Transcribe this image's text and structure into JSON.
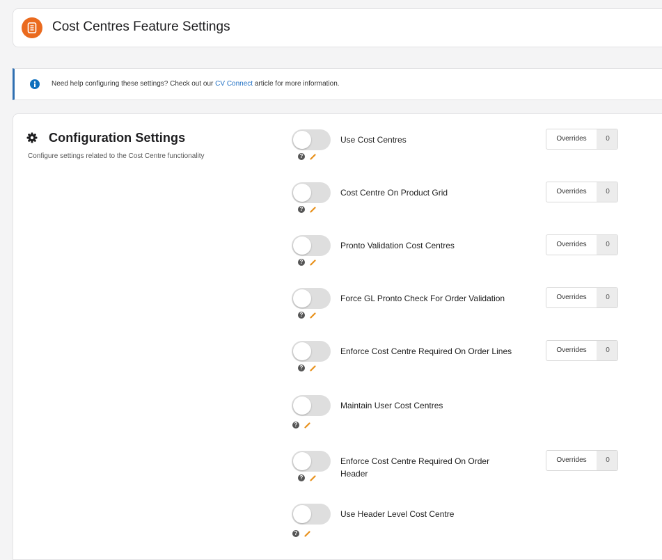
{
  "header": {
    "title": "Cost Centres Feature Settings",
    "icon": "document-icon",
    "accent_color": "#ea6a1e"
  },
  "help": {
    "prefix": "Need help configuring these settings? Check out our ",
    "link_text": "CV Connect",
    "suffix": " article for more information.",
    "icon": "info-icon"
  },
  "config": {
    "title": "Configuration Settings",
    "subtitle": "Configure settings related to the Cost Centre functionality",
    "icon": "gear-icon",
    "overrides_label": "Overrides",
    "settings": [
      {
        "label": "Use Cost Centres",
        "enabled": false,
        "overrides": "0"
      },
      {
        "label": "Cost Centre On Product Grid",
        "enabled": false,
        "overrides": "0"
      },
      {
        "label": "Pronto Validation Cost Centres",
        "enabled": false,
        "overrides": "0"
      },
      {
        "label": "Force GL Pronto Check For Order Validation",
        "enabled": false,
        "overrides": "0"
      },
      {
        "label": "Enforce Cost Centre Required On Order Lines",
        "enabled": false,
        "overrides": "0"
      },
      {
        "label": "Maintain User Cost Centres",
        "enabled": false,
        "overrides": null
      },
      {
        "label": "Enforce Cost Centre Required On Order Header",
        "enabled": false,
        "overrides": "0"
      },
      {
        "label": "Use Header Level Cost Centre",
        "enabled": false,
        "overrides": null
      }
    ]
  }
}
